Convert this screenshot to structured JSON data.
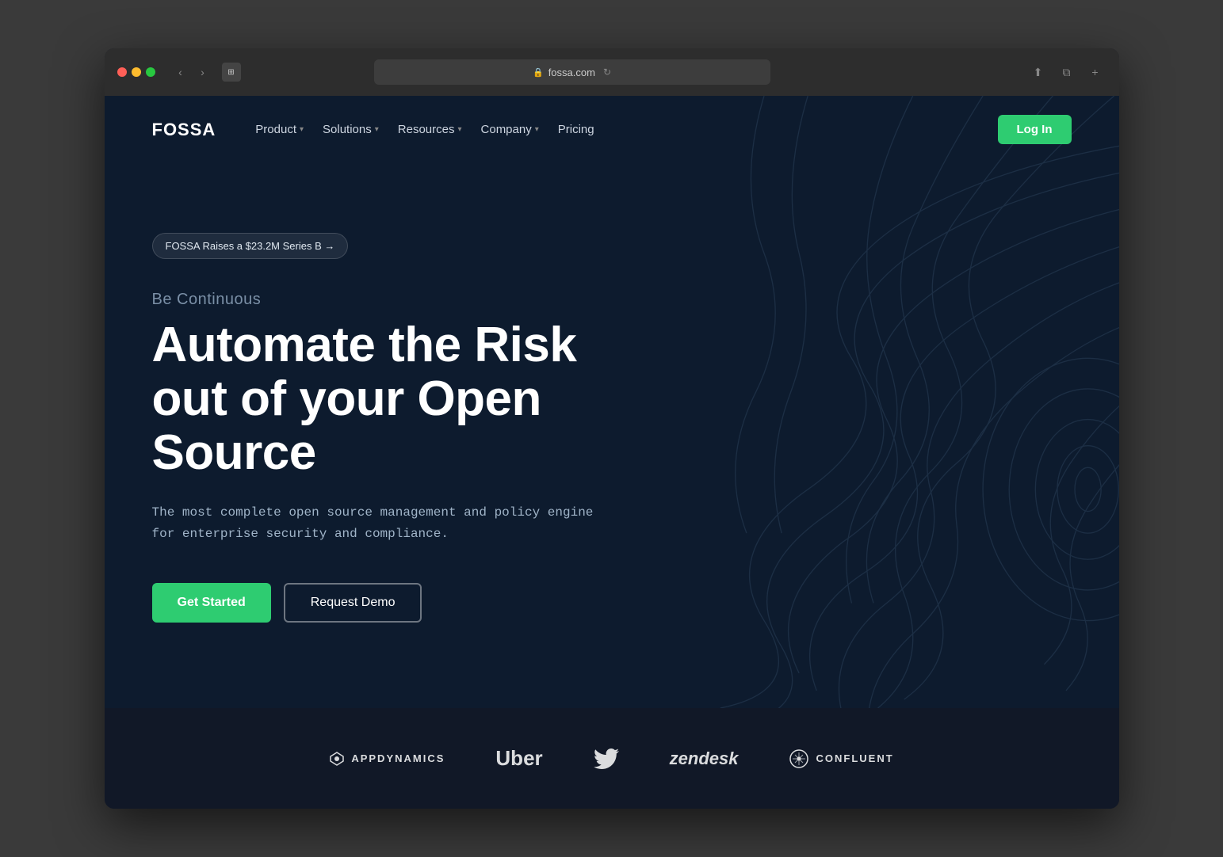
{
  "browser": {
    "url": "fossa.com",
    "tab_icon": "🛡"
  },
  "navbar": {
    "logo": "FOSSA",
    "items": [
      {
        "label": "Product",
        "has_dropdown": true
      },
      {
        "label": "Solutions",
        "has_dropdown": true
      },
      {
        "label": "Resources",
        "has_dropdown": true
      },
      {
        "label": "Company",
        "has_dropdown": true
      },
      {
        "label": "Pricing",
        "has_dropdown": false
      }
    ],
    "login_label": "Log In"
  },
  "hero": {
    "announcement": "FOSSA Raises a $23.2M Series B →",
    "subtitle": "Be Continuous",
    "title": "Automate the Risk out of your Open Source",
    "description": "The most complete open source management and policy engine for enterprise security and compliance.",
    "cta_primary": "Get Started",
    "cta_secondary": "Request Demo"
  },
  "logos": [
    {
      "name": "AppDynamics",
      "display": "APPDYNAMICS",
      "type": "appdynamics"
    },
    {
      "name": "Uber",
      "display": "Uber",
      "type": "uber"
    },
    {
      "name": "Twitter",
      "display": "🐦",
      "type": "twitter"
    },
    {
      "name": "Zendesk",
      "display": "zendesk",
      "type": "zendesk"
    },
    {
      "name": "Confluent",
      "display": "CONFLUENT",
      "type": "confluent"
    }
  ],
  "colors": {
    "accent_green": "#2ecc71",
    "hero_bg": "#0d1b2e",
    "logos_bg": "#111827",
    "text_primary": "#ffffff",
    "text_secondary": "#a0b4c8"
  }
}
